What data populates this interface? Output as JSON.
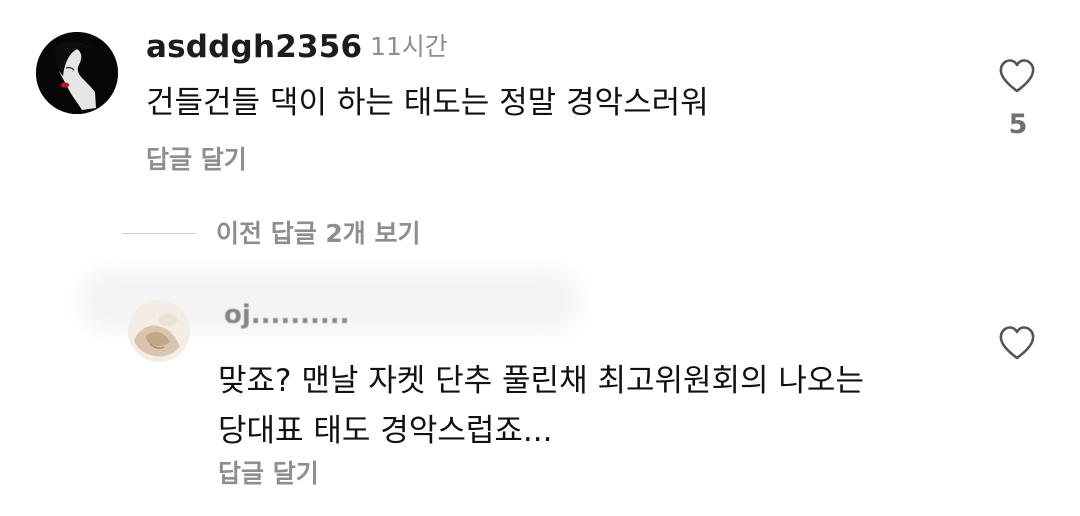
{
  "comment": {
    "username": "asddgh2356",
    "timestamp": "11시간",
    "text": "건들건들 댁이 하는 태도는 정말 경악스러워",
    "reply_label": "답글 달기",
    "like_count": "5",
    "avatar_icon": "woman-silhouette-avatar",
    "heart_icon": "heart-outline-icon"
  },
  "thread": {
    "view_previous_label": "이전 답글 2개 보기"
  },
  "reply": {
    "username": "oj..........",
    "text_line1": "맞죠? 맨날 자켓 단추 풀린채 최고위원회의 나오는",
    "text_line2": "당대표 태도 경악스럽죠...",
    "reply_label": "답글 달기",
    "avatar_icon": "beige-photo-avatar",
    "heart_icon": "heart-outline-icon"
  },
  "colors": {
    "text": "#111111",
    "muted": "#8e8e8e",
    "heart_stroke": "#555555"
  }
}
